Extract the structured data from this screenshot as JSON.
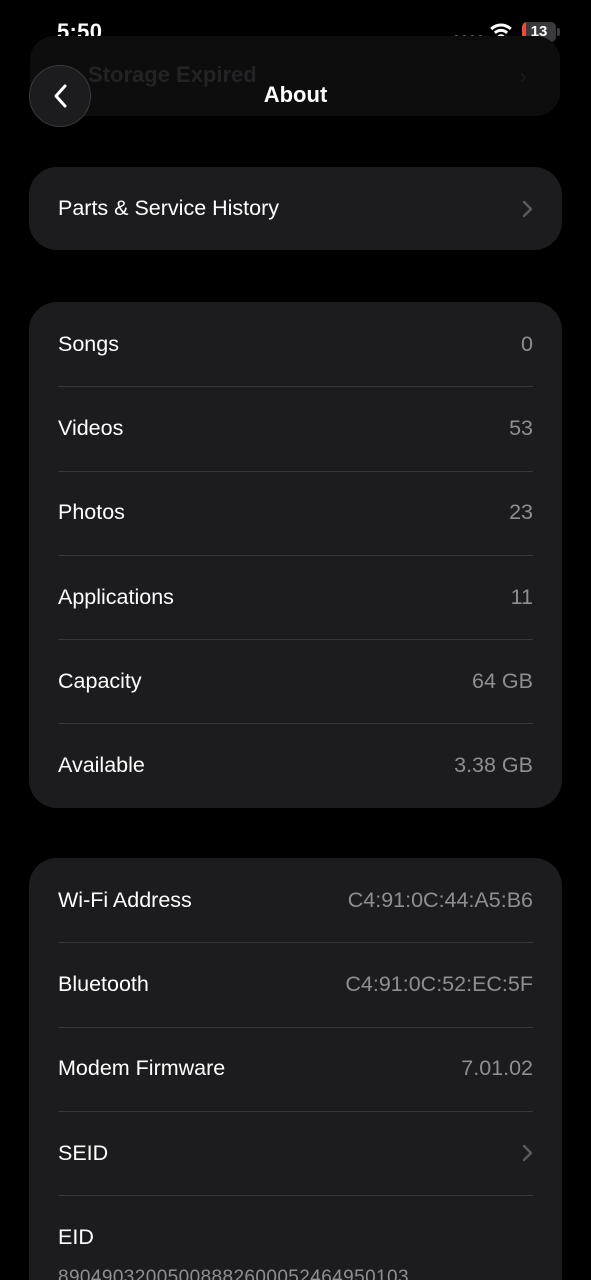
{
  "status_bar": {
    "time": "5:50",
    "battery_level": "13",
    "battery_fraction": 0.13,
    "battery_color": "#eb4d3d"
  },
  "background_banner": {
    "text": "Storage Expired"
  },
  "nav": {
    "title": "About"
  },
  "parts_service": {
    "label": "Parts & Service History"
  },
  "media_group": {
    "rows": [
      {
        "label": "Songs",
        "value": "0"
      },
      {
        "label": "Videos",
        "value": "53"
      },
      {
        "label": "Photos",
        "value": "23"
      },
      {
        "label": "Applications",
        "value": "11"
      },
      {
        "label": "Capacity",
        "value": "64 GB"
      },
      {
        "label": "Available",
        "value": "3.38 GB"
      }
    ]
  },
  "network_group": {
    "rows": [
      {
        "label": "Wi-Fi Address",
        "value": "C4:91:0C:44:A5:B6"
      },
      {
        "label": "Bluetooth",
        "value": "C4:91:0C:52:EC:5F"
      },
      {
        "label": "Modem Firmware",
        "value": "7.01.02"
      },
      {
        "label": "SEID"
      }
    ],
    "eid": {
      "label": "EID",
      "value": "89049032005008882600052464950103"
    }
  },
  "colors": {
    "background": "#000000",
    "group_background": "#1c1c1e",
    "secondary_text": "#8e8e93",
    "separator": "#38383a"
  }
}
